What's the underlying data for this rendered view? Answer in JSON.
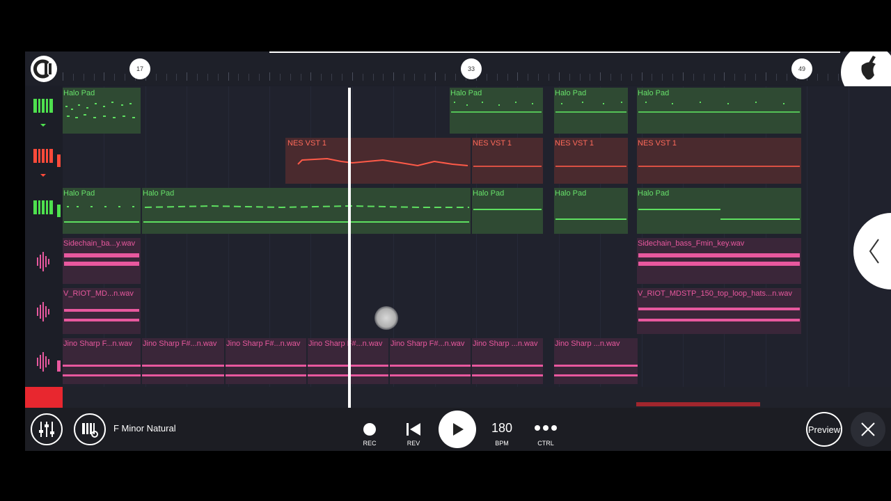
{
  "ruler": {
    "markers": [
      "17",
      "33",
      "49"
    ]
  },
  "tracks": [
    {
      "icon": "piano-icon",
      "color": "#4ee04e",
      "clips": [
        {
          "label": "Halo Pad",
          "type": "green"
        },
        {
          "label": "Halo Pad",
          "type": "green"
        },
        {
          "label": "Halo Pad",
          "type": "green"
        },
        {
          "label": "Halo Pad",
          "type": "green"
        }
      ]
    },
    {
      "icon": "piano-icon",
      "color": "#ff4a3a",
      "clips": [
        {
          "label": "NES VST 1",
          "type": "red"
        },
        {
          "label": "NES VST 1",
          "type": "red"
        },
        {
          "label": "NES VST 1",
          "type": "red"
        },
        {
          "label": "NES VST 1",
          "type": "red"
        }
      ]
    },
    {
      "icon": "piano-icon",
      "color": "#4ee04e",
      "clips": [
        {
          "label": "Halo Pad",
          "type": "green"
        },
        {
          "label": "Halo Pad",
          "type": "green"
        },
        {
          "label": "Halo Pad",
          "type": "green"
        },
        {
          "label": "Halo Pad",
          "type": "green"
        },
        {
          "label": "Halo Pad",
          "type": "green"
        }
      ]
    },
    {
      "icon": "waveform-icon",
      "color": "#e8589e",
      "clips": [
        {
          "label": "Sidechain_ba...y.wav",
          "type": "pink"
        },
        {
          "label": "Sidechain_bass_Fmin_key.wav",
          "type": "pink"
        }
      ]
    },
    {
      "icon": "waveform-icon",
      "color": "#e8589e",
      "clips": [
        {
          "label": "V_RIOT_MD...n.wav",
          "type": "pink"
        },
        {
          "label": "V_RIOT_MDSTP_150_top_loop_hats...n.wav",
          "type": "pink"
        }
      ]
    },
    {
      "icon": "waveform-icon",
      "color": "#e8589e",
      "clips": [
        {
          "label": "Jino Sharp F...n.wav",
          "type": "pink"
        },
        {
          "label": "Jino Sharp F#...n.wav",
          "type": "pink"
        },
        {
          "label": "Jino Sharp F#...n.wav",
          "type": "pink"
        },
        {
          "label": "Jino Sharp F#...n.wav",
          "type": "pink"
        },
        {
          "label": "Jino Sharp F#...n.wav",
          "type": "pink"
        },
        {
          "label": "Jino Sharp ...n.wav",
          "type": "pink"
        },
        {
          "label": "Jino Sharp ...n.wav",
          "type": "pink"
        }
      ]
    }
  ],
  "transport": {
    "scale": "F Minor Natural",
    "rec": "REC",
    "rev": "REV",
    "bpm_value": "180",
    "bpm_label": "BPM",
    "ctrl": "CTRL",
    "preview": "Preview"
  },
  "icons": {
    "mixer": "mixer-icon",
    "piano_settings": "piano-settings-icon",
    "play": "play-icon",
    "close": "close-icon",
    "logo": "fl-logo-icon",
    "fruit": "fl-fruit-icon",
    "collapse": "chevron-left-icon"
  }
}
